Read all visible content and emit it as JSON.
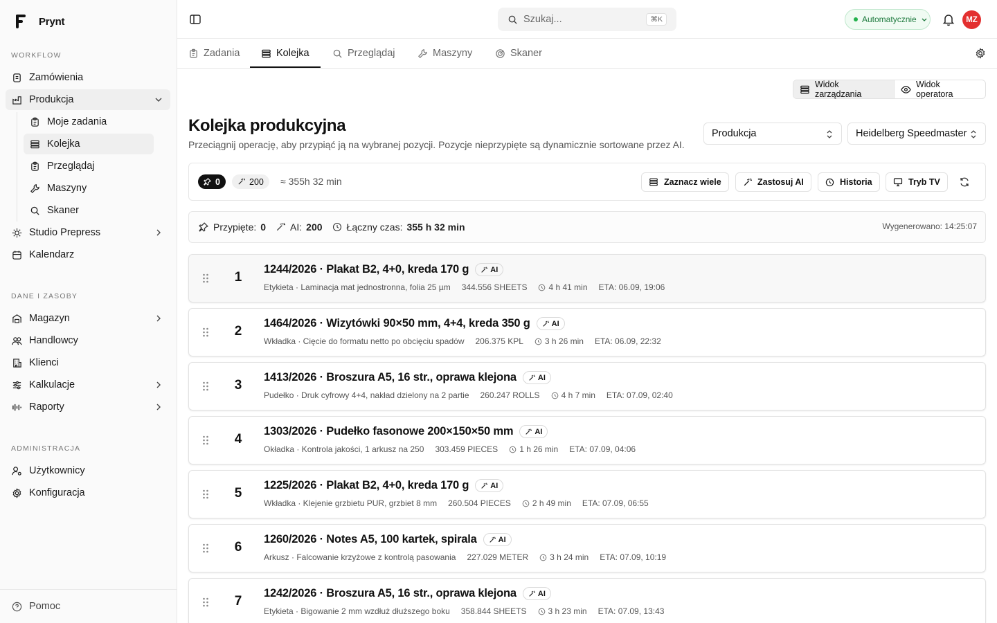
{
  "brand": {
    "name": "Prynt"
  },
  "sidebar": {
    "sections": [
      {
        "label": "WORKFLOW"
      },
      {
        "label": "DANE I ZASOBY"
      },
      {
        "label": "ADMINISTRACJA"
      }
    ],
    "workflow": [
      {
        "label": "Zamówienia",
        "icon": "orders-icon"
      },
      {
        "label": "Produkcja",
        "icon": "factory-icon",
        "expanded": true
      },
      {
        "label": "Studio Prepress",
        "icon": "prepress-icon"
      },
      {
        "label": "Kalendarz",
        "icon": "calendar-icon"
      }
    ],
    "production_sub": [
      {
        "label": "Moje zadania",
        "icon": "clipboard-icon"
      },
      {
        "label": "Kolejka",
        "icon": "queue-icon",
        "active": true
      },
      {
        "label": "Przeglądaj",
        "icon": "clipboard-icon"
      },
      {
        "label": "Maszyny",
        "icon": "wrench-icon"
      },
      {
        "label": "Skaner",
        "icon": "search-icon"
      }
    ],
    "data": [
      {
        "label": "Magazyn",
        "icon": "warehouse-icon"
      },
      {
        "label": "Handlowcy",
        "icon": "users-icon"
      },
      {
        "label": "Klienci",
        "icon": "building-icon"
      },
      {
        "label": "Kalkulacje",
        "icon": "sliders-icon"
      },
      {
        "label": "Raporty",
        "icon": "chart-icon"
      }
    ],
    "admin": [
      {
        "label": "Użytkownicy",
        "icon": "user-cog-icon"
      },
      {
        "label": "Konfiguracja",
        "icon": "gear-icon"
      }
    ],
    "help": {
      "label": "Pomoc",
      "icon": "help-icon"
    }
  },
  "topbar": {
    "search_placeholder": "Szukaj...",
    "search_shortcut": "⌘K",
    "mode_label": "Automatycznie",
    "avatar_initials": "MZ",
    "colors": {
      "mode_green": "#22b14c",
      "avatar_red": "#e33030"
    }
  },
  "tabs": [
    {
      "label": "Zadania",
      "icon": "clipboard-icon"
    },
    {
      "label": "Kolejka",
      "icon": "queue-icon",
      "active": true
    },
    {
      "label": "Przeglądaj",
      "icon": "search-icon"
    },
    {
      "label": "Maszyny",
      "icon": "wrench-icon"
    },
    {
      "label": "Skaner",
      "icon": "scan-icon"
    }
  ],
  "view_toggle": {
    "management": "Widok zarządzania",
    "operator": "Widok operatora"
  },
  "page": {
    "title": "Kolejka produkcyjna",
    "subtitle": "Przeciągnij operację, aby przypiąć ją na wybranej pozycji. Pozycje nieprzypięte są dynamicznie sortowane przez AI.",
    "department_select": "Produkcja",
    "machine_select": "Heidelberg Speedmaster"
  },
  "toolbar": {
    "pinned_count": "0",
    "ai_count": "200",
    "approx_time": "≈ 355h 32 min",
    "select_many": "Zaznacz wiele",
    "apply_ai": "Zastosuj AI",
    "history": "Historia",
    "tv_mode": "Tryb TV"
  },
  "summary": {
    "pinned_label": "Przypięte:",
    "pinned_value": "0",
    "ai_label": "AI:",
    "ai_value": "200",
    "total_label": "Łączny czas:",
    "total_value": "355 h 32 min",
    "generated": "Wygenerowano: 14:25:07"
  },
  "queue": [
    {
      "pos": "1",
      "title": "1244/2026 · Plakat B2, 4+0, kreda 170 g",
      "badge": "AI",
      "part": "Etykieta · Laminacja mat jednostronna, folia 25 µm",
      "qty": "344.556 SHEETS",
      "duration": "4 h 41 min",
      "eta": "ETA: 06.09, 19:06"
    },
    {
      "pos": "2",
      "title": "1464/2026 · Wizytówki 90×50 mm, 4+4, kreda 350 g",
      "badge": "AI",
      "part": "Wkładka · Cięcie do formatu netto po obcięciu spadów",
      "qty": "206.375 KPL",
      "duration": "3 h 26 min",
      "eta": "ETA: 06.09, 22:32"
    },
    {
      "pos": "3",
      "title": "1413/2026 · Broszura A5, 16 str., oprawa klejona",
      "badge": "AI",
      "part": "Pudełko · Druk cyfrowy 4+4, nakład dzielony na 2 partie",
      "qty": "260.247 ROLLS",
      "duration": "4 h 7 min",
      "eta": "ETA: 07.09, 02:40"
    },
    {
      "pos": "4",
      "title": "1303/2026 · Pudełko fasonowe 200×150×50 mm",
      "badge": "AI",
      "part": "Okładka · Kontrola jakości, 1 arkusz na 250",
      "qty": "303.459 PIECES",
      "duration": "1 h 26 min",
      "eta": "ETA: 07.09, 04:06"
    },
    {
      "pos": "5",
      "title": "1225/2026 · Plakat B2, 4+0, kreda 170 g",
      "badge": "AI",
      "part": "Wkładka · Klejenie grzbietu PUR, grzbiet 8 mm",
      "qty": "260.504 PIECES",
      "duration": "2 h 49 min",
      "eta": "ETA: 07.09, 06:55"
    },
    {
      "pos": "6",
      "title": "1260/2026 · Notes A5, 100 kartek, spirala",
      "badge": "AI",
      "part": "Arkusz · Falcowanie krzyżowe z kontrolą pasowania",
      "qty": "227.029 METER",
      "duration": "3 h 24 min",
      "eta": "ETA: 07.09, 10:19"
    },
    {
      "pos": "7",
      "title": "1242/2026 · Broszura A5, 16 str., oprawa klejona",
      "badge": "AI",
      "part": "Etykieta · Bigowanie 2 mm wzdłuż dłuższego boku",
      "qty": "358.844 SHEETS",
      "duration": "3 h 23 min",
      "eta": "ETA: 07.09, 13:43"
    }
  ]
}
